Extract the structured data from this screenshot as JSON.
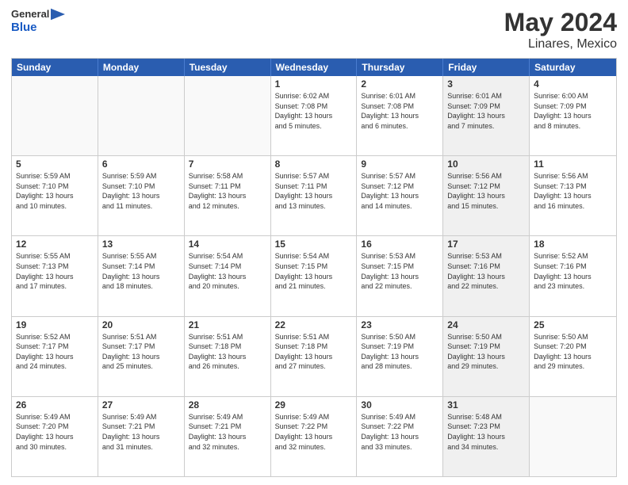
{
  "header": {
    "logo_general": "General",
    "logo_blue": "Blue",
    "main_title": "May 2024",
    "subtitle": "Linares, Mexico"
  },
  "weekdays": [
    "Sunday",
    "Monday",
    "Tuesday",
    "Wednesday",
    "Thursday",
    "Friday",
    "Saturday"
  ],
  "rows": [
    {
      "cells": [
        {
          "day": "",
          "info": "",
          "shade": "empty"
        },
        {
          "day": "",
          "info": "",
          "shade": "empty"
        },
        {
          "day": "",
          "info": "",
          "shade": "empty"
        },
        {
          "day": "1",
          "info": "Sunrise: 6:02 AM\nSunset: 7:08 PM\nDaylight: 13 hours\nand 5 minutes.",
          "shade": ""
        },
        {
          "day": "2",
          "info": "Sunrise: 6:01 AM\nSunset: 7:08 PM\nDaylight: 13 hours\nand 6 minutes.",
          "shade": ""
        },
        {
          "day": "3",
          "info": "Sunrise: 6:01 AM\nSunset: 7:09 PM\nDaylight: 13 hours\nand 7 minutes.",
          "shade": "shaded"
        },
        {
          "day": "4",
          "info": "Sunrise: 6:00 AM\nSunset: 7:09 PM\nDaylight: 13 hours\nand 8 minutes.",
          "shade": ""
        }
      ]
    },
    {
      "cells": [
        {
          "day": "5",
          "info": "Sunrise: 5:59 AM\nSunset: 7:10 PM\nDaylight: 13 hours\nand 10 minutes.",
          "shade": ""
        },
        {
          "day": "6",
          "info": "Sunrise: 5:59 AM\nSunset: 7:10 PM\nDaylight: 13 hours\nand 11 minutes.",
          "shade": ""
        },
        {
          "day": "7",
          "info": "Sunrise: 5:58 AM\nSunset: 7:11 PM\nDaylight: 13 hours\nand 12 minutes.",
          "shade": ""
        },
        {
          "day": "8",
          "info": "Sunrise: 5:57 AM\nSunset: 7:11 PM\nDaylight: 13 hours\nand 13 minutes.",
          "shade": ""
        },
        {
          "day": "9",
          "info": "Sunrise: 5:57 AM\nSunset: 7:12 PM\nDaylight: 13 hours\nand 14 minutes.",
          "shade": ""
        },
        {
          "day": "10",
          "info": "Sunrise: 5:56 AM\nSunset: 7:12 PM\nDaylight: 13 hours\nand 15 minutes.",
          "shade": "shaded"
        },
        {
          "day": "11",
          "info": "Sunrise: 5:56 AM\nSunset: 7:13 PM\nDaylight: 13 hours\nand 16 minutes.",
          "shade": ""
        }
      ]
    },
    {
      "cells": [
        {
          "day": "12",
          "info": "Sunrise: 5:55 AM\nSunset: 7:13 PM\nDaylight: 13 hours\nand 17 minutes.",
          "shade": ""
        },
        {
          "day": "13",
          "info": "Sunrise: 5:55 AM\nSunset: 7:14 PM\nDaylight: 13 hours\nand 18 minutes.",
          "shade": ""
        },
        {
          "day": "14",
          "info": "Sunrise: 5:54 AM\nSunset: 7:14 PM\nDaylight: 13 hours\nand 20 minutes.",
          "shade": ""
        },
        {
          "day": "15",
          "info": "Sunrise: 5:54 AM\nSunset: 7:15 PM\nDaylight: 13 hours\nand 21 minutes.",
          "shade": ""
        },
        {
          "day": "16",
          "info": "Sunrise: 5:53 AM\nSunset: 7:15 PM\nDaylight: 13 hours\nand 22 minutes.",
          "shade": ""
        },
        {
          "day": "17",
          "info": "Sunrise: 5:53 AM\nSunset: 7:16 PM\nDaylight: 13 hours\nand 22 minutes.",
          "shade": "shaded"
        },
        {
          "day": "18",
          "info": "Sunrise: 5:52 AM\nSunset: 7:16 PM\nDaylight: 13 hours\nand 23 minutes.",
          "shade": ""
        }
      ]
    },
    {
      "cells": [
        {
          "day": "19",
          "info": "Sunrise: 5:52 AM\nSunset: 7:17 PM\nDaylight: 13 hours\nand 24 minutes.",
          "shade": ""
        },
        {
          "day": "20",
          "info": "Sunrise: 5:51 AM\nSunset: 7:17 PM\nDaylight: 13 hours\nand 25 minutes.",
          "shade": ""
        },
        {
          "day": "21",
          "info": "Sunrise: 5:51 AM\nSunset: 7:18 PM\nDaylight: 13 hours\nand 26 minutes.",
          "shade": ""
        },
        {
          "day": "22",
          "info": "Sunrise: 5:51 AM\nSunset: 7:18 PM\nDaylight: 13 hours\nand 27 minutes.",
          "shade": ""
        },
        {
          "day": "23",
          "info": "Sunrise: 5:50 AM\nSunset: 7:19 PM\nDaylight: 13 hours\nand 28 minutes.",
          "shade": ""
        },
        {
          "day": "24",
          "info": "Sunrise: 5:50 AM\nSunset: 7:19 PM\nDaylight: 13 hours\nand 29 minutes.",
          "shade": "shaded"
        },
        {
          "day": "25",
          "info": "Sunrise: 5:50 AM\nSunset: 7:20 PM\nDaylight: 13 hours\nand 29 minutes.",
          "shade": ""
        }
      ]
    },
    {
      "cells": [
        {
          "day": "26",
          "info": "Sunrise: 5:49 AM\nSunset: 7:20 PM\nDaylight: 13 hours\nand 30 minutes.",
          "shade": ""
        },
        {
          "day": "27",
          "info": "Sunrise: 5:49 AM\nSunset: 7:21 PM\nDaylight: 13 hours\nand 31 minutes.",
          "shade": ""
        },
        {
          "day": "28",
          "info": "Sunrise: 5:49 AM\nSunset: 7:21 PM\nDaylight: 13 hours\nand 32 minutes.",
          "shade": ""
        },
        {
          "day": "29",
          "info": "Sunrise: 5:49 AM\nSunset: 7:22 PM\nDaylight: 13 hours\nand 32 minutes.",
          "shade": ""
        },
        {
          "day": "30",
          "info": "Sunrise: 5:49 AM\nSunset: 7:22 PM\nDaylight: 13 hours\nand 33 minutes.",
          "shade": ""
        },
        {
          "day": "31",
          "info": "Sunrise: 5:48 AM\nSunset: 7:23 PM\nDaylight: 13 hours\nand 34 minutes.",
          "shade": "shaded"
        },
        {
          "day": "",
          "info": "",
          "shade": "empty"
        }
      ]
    }
  ]
}
